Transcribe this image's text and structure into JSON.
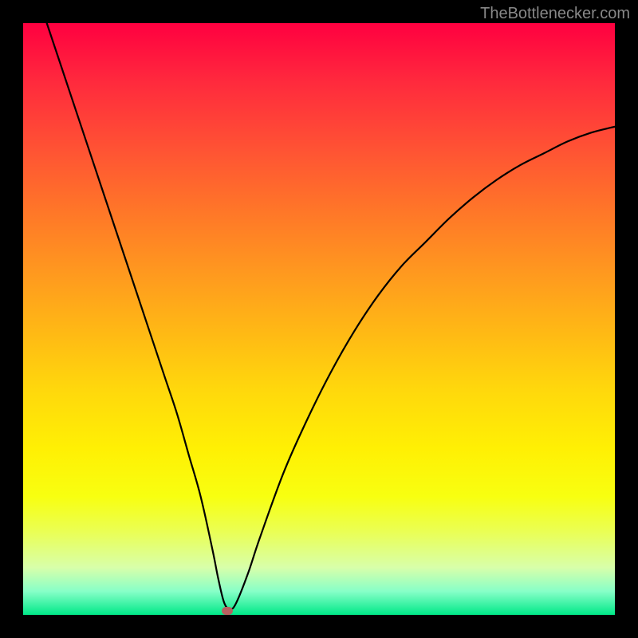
{
  "attribution": "TheBottlenecker.com",
  "chart_data": {
    "type": "line",
    "title": "",
    "xlabel": "",
    "ylabel": "",
    "xlim": [
      0,
      100
    ],
    "ylim": [
      0,
      100
    ],
    "series": [
      {
        "name": "curve",
        "x": [
          4,
          6,
          8,
          10,
          12,
          14,
          16,
          18,
          20,
          22,
          24,
          26,
          28,
          30,
          32,
          33,
          34,
          35,
          36,
          38,
          40,
          44,
          48,
          52,
          56,
          60,
          64,
          68,
          72,
          76,
          80,
          84,
          88,
          92,
          96,
          100
        ],
        "y": [
          100,
          94,
          88,
          82,
          76,
          70,
          64,
          58,
          52,
          46,
          40,
          34,
          27,
          20,
          11,
          6,
          2,
          1,
          2,
          7,
          13,
          24,
          33,
          41,
          48,
          54,
          59,
          63,
          67,
          70.5,
          73.5,
          76,
          78,
          80,
          81.5,
          82.5
        ]
      }
    ],
    "marker": {
      "x": 34.5,
      "y": 0.7
    },
    "colors": {
      "curve": "#000000",
      "marker": "#b86060",
      "gradient_top": "#ff0040",
      "gradient_bottom": "#00e888"
    }
  }
}
